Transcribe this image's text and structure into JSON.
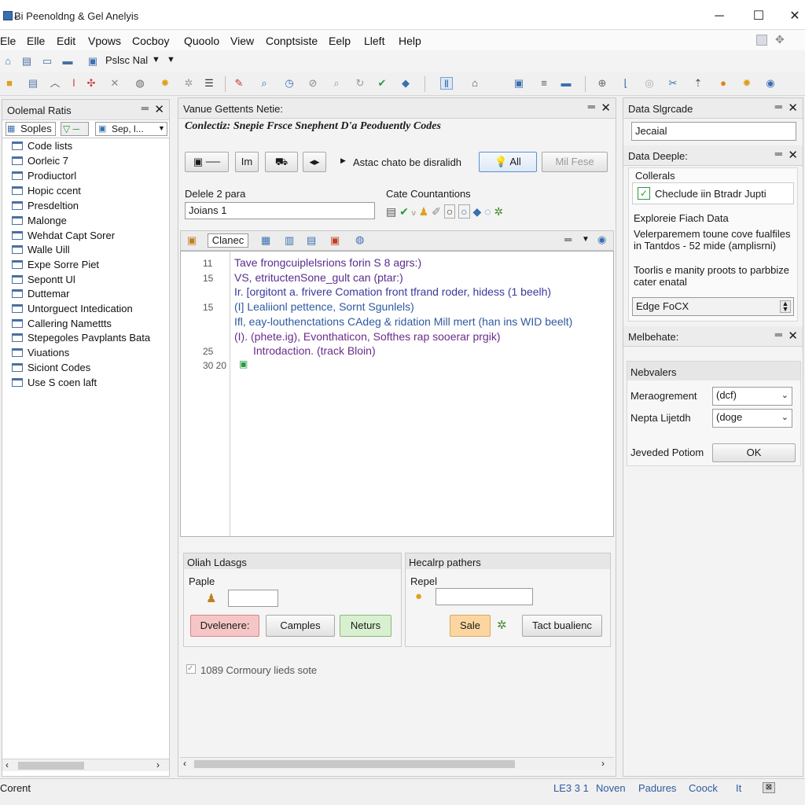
{
  "window": {
    "title": "Ƀi Peenoldng & Gel Anelyis"
  },
  "menu": [
    "Ele",
    "Elle",
    "Edit",
    "Vpows",
    "Cocboy",
    "Quoolo",
    "View",
    "Conptsiste",
    "Eelp",
    "Lleft",
    "Help"
  ],
  "toolbar1": {
    "combo_value": "Pslsc Nal"
  },
  "left_panel": {
    "title": "Oolemal Ratis",
    "filter_label": "Soples",
    "filter_select": "Sep, l...",
    "items": [
      "Code lists",
      "Oorleic 7",
      "Prodiuctorl",
      "Hopic ccent",
      "Presdeltion",
      "Malonge",
      "Wehdat Capt Sorer",
      "Walle Uill",
      "Expe Sorre Piet",
      "Sepontt Ul",
      "Duttemar",
      "Untorguect Intedication",
      "Callering Namettts",
      "Stepegoles Pavplants Bata",
      "Viuations",
      "Siciont Codes",
      "Use S coen laft"
    ]
  },
  "center": {
    "header_title": "Vanue Gettents Netie:",
    "heading": "Conlectiz: Snepie Frsce Snephent D'a Peoduently Codes",
    "btn_im": "Im",
    "action_label": "Astac chato be disralidh",
    "btn_all": "All",
    "btn_mil": "Mil Fese",
    "delete_label": "Delele 2 para",
    "delete_value": "Joians 1",
    "cate_label": "Cate Countantions",
    "code_tab_label": "Clanec",
    "code_lines": [
      {
        "no": "11",
        "text": "Tave frongcuiplelsrions forin S 8 agrs:)",
        "color": "#5a2c8e"
      },
      {
        "no": "15",
        "text": "VS, etrituctenSone_gult can (ptar:)",
        "color": "#5a2c8e"
      },
      {
        "no": "",
        "text": "Ir. [orgitont a. frivere Comation front tfrand roder, hidess (1 beelh)",
        "color": "#3a3a9c"
      },
      {
        "no": "15",
        "text": "(I]  Lealiionl pettence, Sornt Sgunlels)",
        "color": "#2f5aa0"
      },
      {
        "no": "",
        "text": "Ifl, eay-louthenctations  CAdeg & ridation Mill mert (han ins WID beelt)",
        "color": "#2f5aa0"
      },
      {
        "no": "",
        "text": "(I). (phete.ig), Evonthaticon, Softhes rap sooerar prgik)",
        "color": "#6a2b8a"
      },
      {
        "no": "25",
        "text": "Introdaction. (track Bloin)",
        "color": "#6a2b8a"
      },
      {
        "no": "30 20",
        "text": "",
        "color": "#333"
      }
    ],
    "oliah_title": "Oliah Ldasgs",
    "paple_label": "Paple",
    "btn_dvelenere": "Dvelenere:",
    "btn_camples": "Camples",
    "btn_neturs": "Neturs",
    "hecalp_title": "Hecalrp pathers",
    "repel_label": "Repel",
    "btn_sale": "Sale",
    "btn_tact": "Tact bualienc",
    "checkbox_label": "1089 Cormoury lieds sote"
  },
  "right": {
    "data_title": "Data Slgrcade",
    "search_value": "Jecaial",
    "deeple_title": "Data Deeple:",
    "collerals_label": "Collerals",
    "checkbox_item": "Checlude iin Btradr Jupti",
    "explore_title": "Exploreie Fiach Data",
    "explore_text1": "Velerparemem toune cove fualfiles in Tantdos - 52 mide (amplisrni)",
    "explore_text2": "Toorlis e manity proots to parbbize cater enatal",
    "edge_field": "Edge FoCX",
    "melbe_title": "Melbehate:",
    "nebv_title": "Nebvalers",
    "mera_label": "Meraogrement",
    "mera_value": "(dcf)",
    "nepta_label": "Nepta Lijetdh",
    "nepta_value": "(doge",
    "jeved_label": "Jeveded Potiom",
    "ok_label": "OK"
  },
  "status": {
    "left": "Corent",
    "items": [
      "LE3 3 1",
      "Noven",
      "Padures",
      "Coock",
      "It"
    ]
  }
}
